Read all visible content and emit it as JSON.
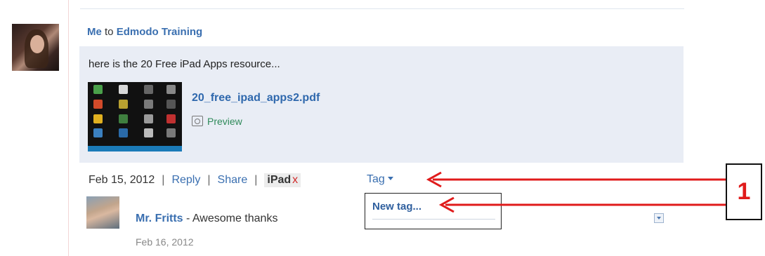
{
  "post": {
    "sender": "Me",
    "to_word": " to ",
    "recipient": "Edmodo Training",
    "message": "here is the 20 Free iPad Apps resource...",
    "attachment": {
      "filename": "20_free_ipad_apps2.pdf",
      "preview_label": "Preview"
    },
    "date": "Feb 15, 2012",
    "reply_label": "Reply",
    "share_label": "Share",
    "tag_chip": "iPad",
    "tag_chip_remove": "x",
    "tag_menu_label": "Tag",
    "new_tag_label": "New tag..."
  },
  "comment": {
    "author": "Mr. Fritts",
    "text": " - Awesome thanks",
    "date": "Feb 16, 2012"
  },
  "callout": {
    "number": "1",
    "color": "#e01b1b"
  }
}
